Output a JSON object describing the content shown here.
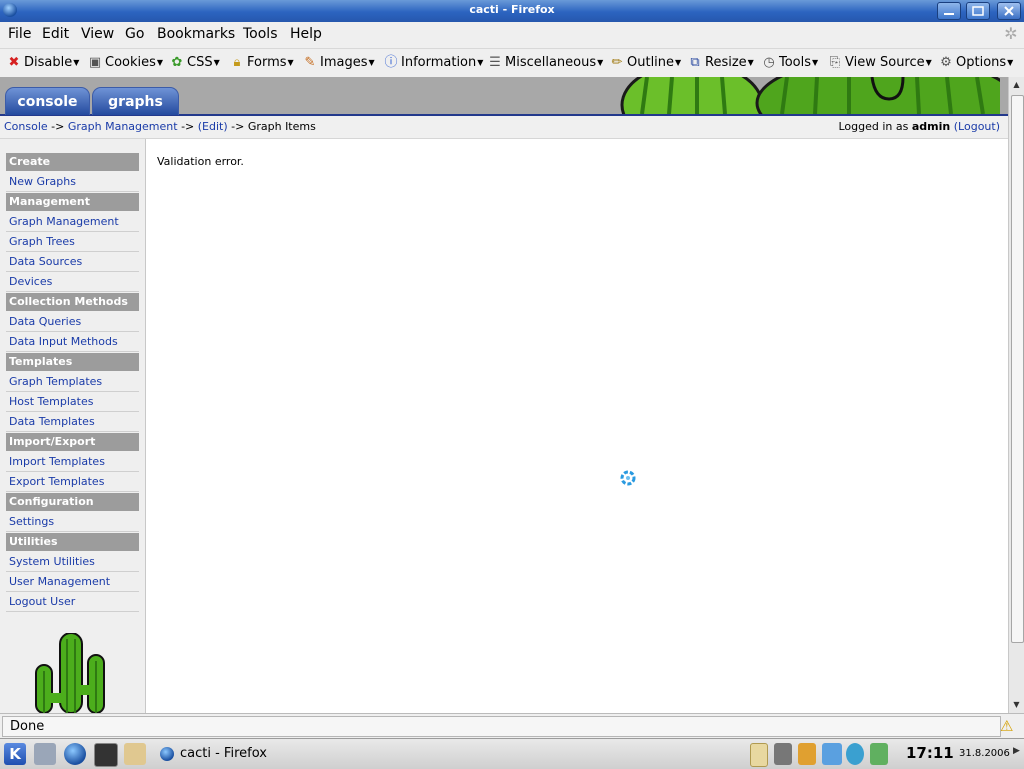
{
  "window": {
    "title": "cacti - Firefox"
  },
  "menubar": {
    "items": [
      "File",
      "Edit",
      "View",
      "Go",
      "Bookmarks",
      "Tools",
      "Help"
    ]
  },
  "toolbar": {
    "items": [
      {
        "label": "Disable",
        "icon": "disable-icon"
      },
      {
        "label": "Cookies",
        "icon": "cookies-icon"
      },
      {
        "label": "CSS",
        "icon": "css-icon"
      },
      {
        "label": "Forms",
        "icon": "forms-icon"
      },
      {
        "label": "Images",
        "icon": "images-icon"
      },
      {
        "label": "Information",
        "icon": "information-icon"
      },
      {
        "label": "Miscellaneous",
        "icon": "miscellaneous-icon"
      },
      {
        "label": "Outline",
        "icon": "outline-icon"
      },
      {
        "label": "Resize",
        "icon": "resize-icon"
      },
      {
        "label": "Tools",
        "icon": "tools-icon"
      },
      {
        "label": "View Source",
        "icon": "view-source-icon"
      },
      {
        "label": "Options",
        "icon": "options-icon"
      }
    ]
  },
  "tabs": [
    "console",
    "graphs"
  ],
  "breadcrumbs": {
    "items": [
      "Console",
      "Graph Management",
      "(Edit)"
    ],
    "separator": "->",
    "current": "Graph Items"
  },
  "login": {
    "prefix": "Logged in as",
    "user": "admin",
    "logout": "(Logout)"
  },
  "sidebar": {
    "sections": [
      {
        "title": "Create",
        "items": [
          "New Graphs"
        ]
      },
      {
        "title": "Management",
        "items": [
          "Graph Management",
          "Graph Trees",
          "Data Sources",
          "Devices"
        ]
      },
      {
        "title": "Collection Methods",
        "items": [
          "Data Queries",
          "Data Input Methods"
        ]
      },
      {
        "title": "Templates",
        "items": [
          "Graph Templates",
          "Host Templates",
          "Data Templates"
        ]
      },
      {
        "title": "Import/Export",
        "items": [
          "Import Templates",
          "Export Templates"
        ]
      },
      {
        "title": "Configuration",
        "items": [
          "Settings"
        ]
      },
      {
        "title": "Utilities",
        "items": [
          "System Utilities",
          "User Management",
          "Logout User"
        ]
      }
    ]
  },
  "content": {
    "message": "Validation error."
  },
  "statusbar": {
    "text": "Done"
  },
  "taskbar": {
    "window_label": "cacti - Firefox",
    "time": "17:11",
    "date": "31.8.2006"
  },
  "colors": {
    "link": "#1a3ba8",
    "tab": "#2f5aae",
    "section_header": "#9c9c9c",
    "titlebar": "#2c64c0"
  }
}
